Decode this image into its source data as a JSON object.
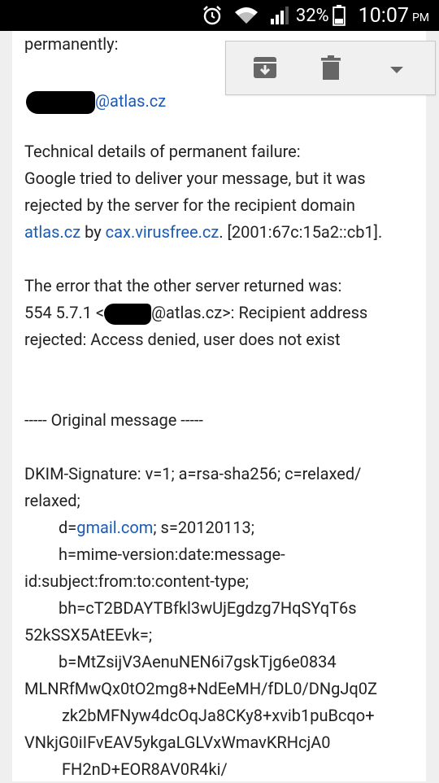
{
  "status_bar": {
    "battery_percent": "32%",
    "time": "10:07",
    "ampm": "PM"
  },
  "toolbar": {
    "archive_icon": "archive-icon",
    "delete_icon": "trash-icon",
    "more_icon": "dropdown-arrow-icon"
  },
  "message": {
    "line_permanently": "permanently:",
    "redacted_email_domain": "@atlas.cz",
    "tech_heading": "Technical details of permanent failure:",
    "tech_line_1": "Google tried to deliver your message, but it was",
    "tech_line_2": "rejected by the server for the recipient domain",
    "domain_link": "atlas.cz",
    "by_text": " by ",
    "server_link": "cax.virusfree.cz",
    "ip_text": ". [2001:67c:15a2::cb1].",
    "error_heading": "The error that the other server returned was:",
    "error_code": "554 5.7.1 <",
    "error_email_domain": "@atlas.cz",
    "error_tail": ">: Recipient address",
    "error_line_2": "rejected: Access denied, user does not exist",
    "original_header": "----- Original message -----",
    "dkim_1": "DKIM-Signature: v=1; a=rsa-sha256; c=relaxed/",
    "dkim_2": "relaxed;",
    "dkim_d_prefix": "d=",
    "dkim_d_link": "gmail.com",
    "dkim_d_suffix": "; s=20120113;",
    "dkim_h_1": "h=mime-version:date:message-",
    "dkim_h_2": "id:subject:from:to:content-type;",
    "dkim_bh_1": "bh=cT2BDAYTBfkl3wUjEgdzg7HqSYqT6s",
    "dkim_bh_2": "52kSSX5AtEEvk=;",
    "dkim_b_1": "b=MtZsijV3AenuNEN6i7gskTjg6e0834",
    "dkim_b_2": "MLNRfMwQx0tO2mg8+NdEeMH/fDL0/DNgJq0Z",
    "dkim_b_3": "zk2bMFNyw4dcOqJa8CKy8+xvib1puBcqo+",
    "dkim_b_4": "VNkjG0iIFvEAV5ykgaLGLVxWmavKRHcjA0",
    "dkim_b_5": "FH2nD+EOR8AV0R4ki/"
  },
  "colors": {
    "link": "#1a5bb8",
    "background": "#efefef",
    "card": "#ffffff",
    "toolbar_bg": "#f0f0f0",
    "icon": "#666666"
  }
}
